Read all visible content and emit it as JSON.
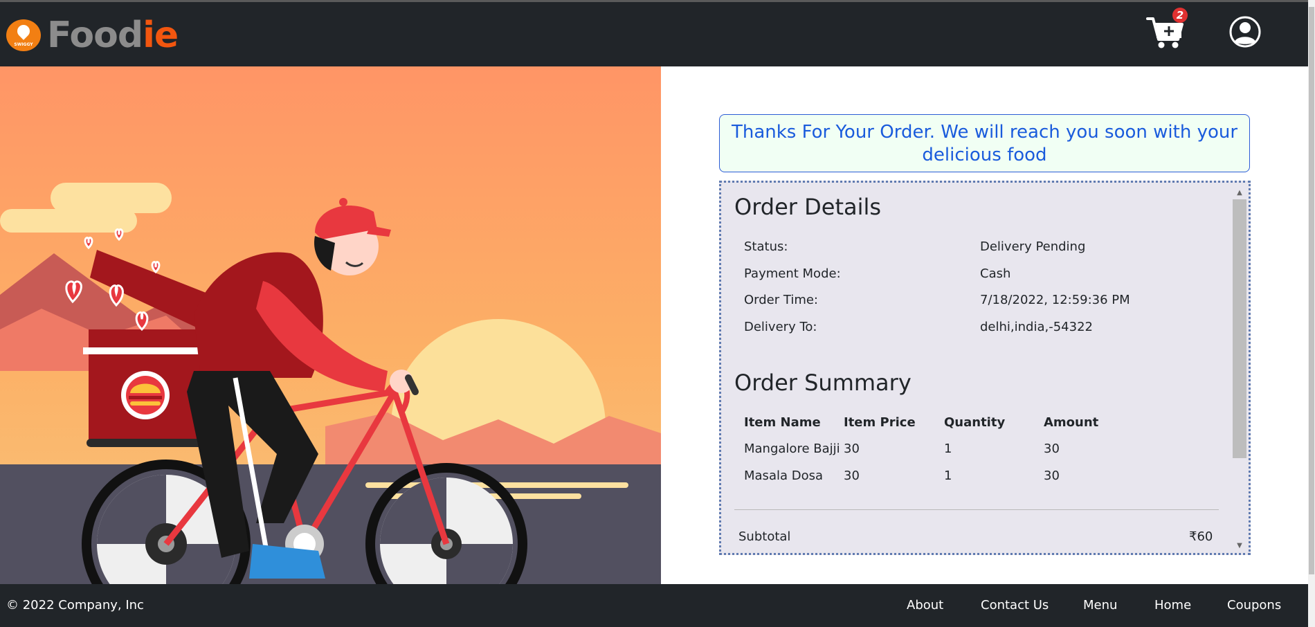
{
  "header": {
    "brand_part1": "Food",
    "brand_part2": "ie",
    "logo_text": "SWIGGY",
    "cart_count": "2"
  },
  "thanks_message": "Thanks For Your Order. We will reach you soon with your delicious food",
  "order_details": {
    "title": "Order Details",
    "rows": [
      {
        "label": "Status:",
        "value": "Delivery Pending"
      },
      {
        "label": "Payment Mode:",
        "value": "Cash"
      },
      {
        "label": "Order Time:",
        "value": "7/18/2022, 12:59:36 PM"
      },
      {
        "label": "Delivery To:",
        "value": "delhi,india,-54322"
      }
    ]
  },
  "order_summary": {
    "title": "Order Summary",
    "columns": [
      "Item Name",
      "Item Price",
      "Quantity",
      "Amount"
    ],
    "items": [
      [
        "Mangalore Bajji",
        "30",
        "1",
        "30"
      ],
      [
        "Masala Dosa",
        "30",
        "1",
        "30"
      ]
    ],
    "subtotal_label": "Subtotal",
    "subtotal_value": "₹60"
  },
  "footer": {
    "copyright": "© 2022 Company, Inc",
    "links": [
      "About",
      "Contact Us",
      "Menu",
      "Home",
      "Coupons"
    ]
  },
  "icons": {
    "cart": "shopping-cart-icon",
    "profile": "user-circle-icon",
    "logo": "swiggy-logo"
  },
  "colors": {
    "navbar": "#212529",
    "brand_grey": "#8c8c8c",
    "brand_orange": "#f2560f",
    "accent_blue": "#1a5bdc",
    "panel_bg": "#e8e6ee"
  }
}
